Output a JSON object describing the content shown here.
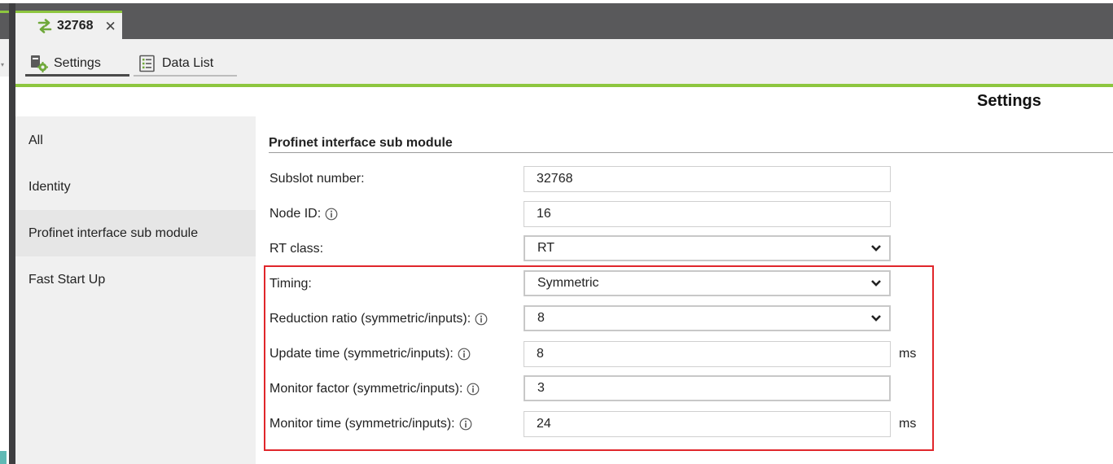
{
  "tab": {
    "title": "32768",
    "icon": "swap-arrows-icon",
    "accent_color": "#8dc63f"
  },
  "toolbar": {
    "settings_label": "Settings",
    "datalist_label": "Data List"
  },
  "page_title": "Settings",
  "sidebar": {
    "items": [
      {
        "label": "All"
      },
      {
        "label": "Identity"
      },
      {
        "label": "Profinet interface sub module",
        "active": true
      },
      {
        "label": "Fast Start Up"
      }
    ]
  },
  "section": {
    "title": "Profinet interface sub module",
    "rows": [
      {
        "label": "Subslot number:",
        "value": "32768",
        "kind": "input",
        "info": false
      },
      {
        "label": "Node ID:",
        "value": "16",
        "kind": "input",
        "info": true
      },
      {
        "label": "RT class:",
        "value": "RT",
        "kind": "select",
        "info": false
      },
      {
        "label": "Timing:",
        "value": "Symmetric",
        "kind": "select",
        "info": false
      },
      {
        "label": "Reduction ratio (symmetric/inputs):",
        "value": "8",
        "kind": "select",
        "info": true
      },
      {
        "label": "Update time (symmetric/inputs):",
        "value": "8",
        "kind": "input",
        "info": true,
        "unit": "ms"
      },
      {
        "label": "Monitor factor (symmetric/inputs):",
        "value": "3",
        "kind": "input",
        "info": true
      },
      {
        "label": "Monitor time (symmetric/inputs):",
        "value": "24",
        "kind": "input",
        "info": true,
        "unit": "ms"
      }
    ]
  },
  "highlight_color": "#e0262b"
}
